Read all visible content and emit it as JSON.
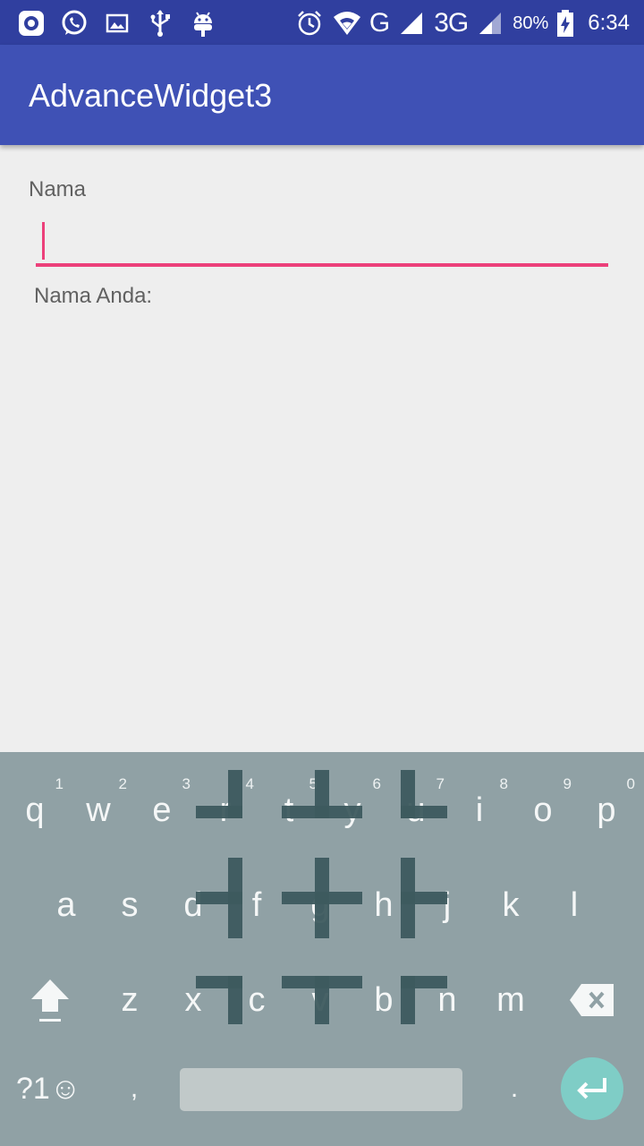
{
  "status_bar": {
    "network_label": "G",
    "network_3g_label": "3G",
    "battery_percent": "80%",
    "time": "6:34",
    "left_icons": [
      "camera-icon",
      "whatsapp-icon",
      "image-icon",
      "usb-icon",
      "android-icon"
    ],
    "right_icons": [
      "alarm-icon",
      "wifi-icon",
      "signal-icon",
      "signal-icon",
      "battery-charging-icon"
    ]
  },
  "app_bar": {
    "title": "AdvanceWidget3"
  },
  "form": {
    "name_label": "Nama",
    "name_value": "",
    "result_label": "Nama Anda:"
  },
  "keyboard": {
    "row1": [
      {
        "ch": "q",
        "hint": "1"
      },
      {
        "ch": "w",
        "hint": "2"
      },
      {
        "ch": "e",
        "hint": "3"
      },
      {
        "ch": "r",
        "hint": "4"
      },
      {
        "ch": "t",
        "hint": "5"
      },
      {
        "ch": "y",
        "hint": "6"
      },
      {
        "ch": "u",
        "hint": "7"
      },
      {
        "ch": "i",
        "hint": "8"
      },
      {
        "ch": "o",
        "hint": "9"
      },
      {
        "ch": "p",
        "hint": "0"
      }
    ],
    "row2": [
      "a",
      "s",
      "d",
      "f",
      "g",
      "h",
      "j",
      "k",
      "l"
    ],
    "row3": [
      "z",
      "x",
      "c",
      "v",
      "b",
      "n",
      "m"
    ],
    "symbols_label": "?1☺",
    "comma_label": ",",
    "period_label": ".",
    "colors": {
      "background": "#90a1a5",
      "enter": "#7fcdc6",
      "space": "#c1c9c9"
    }
  },
  "colors": {
    "status_bar": "#303f9f",
    "app_bar": "#3f51b5",
    "accent": "#ec407a",
    "background": "#eeeeee"
  }
}
